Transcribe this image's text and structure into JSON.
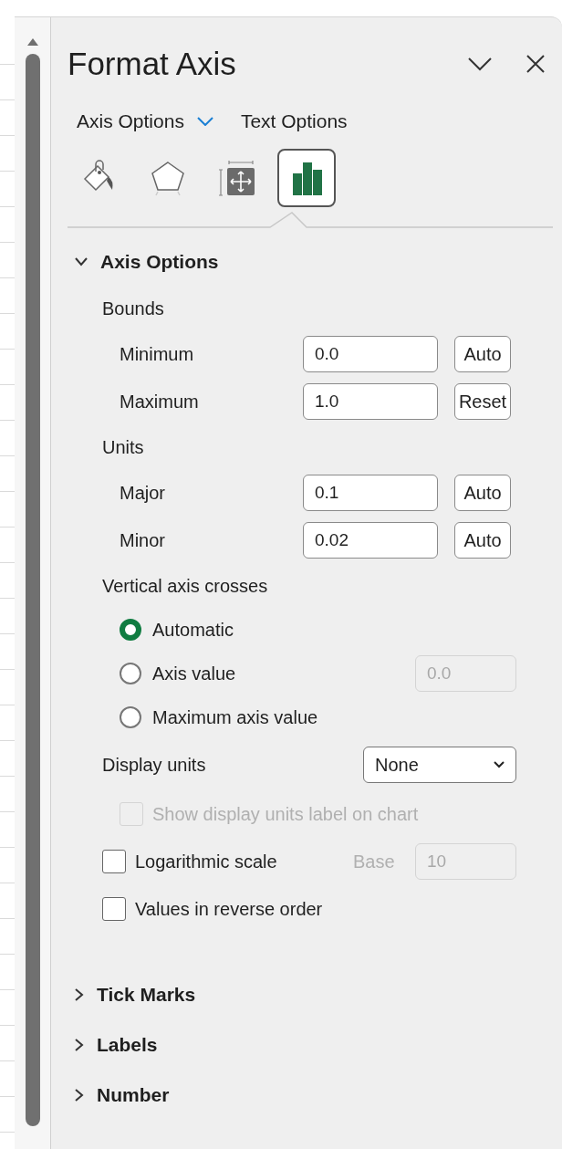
{
  "title": "Format Axis",
  "option_tabs": [
    {
      "label": "Axis Options",
      "menu": true
    },
    {
      "label": "Text Options",
      "menu": false
    }
  ],
  "icon_tabs": [
    {
      "kind": "fill",
      "selected": false
    },
    {
      "kind": "effects",
      "selected": false
    },
    {
      "kind": "size",
      "selected": false
    },
    {
      "kind": "axis",
      "selected": true
    }
  ],
  "sections": [
    {
      "title": "Axis Options",
      "expanded": true,
      "items": [
        {
          "kind": "heading",
          "label": "Bounds"
        },
        {
          "kind": "bound",
          "label": "Minimum",
          "value": "0.0",
          "button": "Auto"
        },
        {
          "kind": "bound",
          "label": "Maximum",
          "value": "1.0",
          "button": "Reset"
        },
        {
          "kind": "heading",
          "label": "Units"
        },
        {
          "kind": "bound",
          "label": "Major",
          "value": "0.1",
          "button": "Auto"
        },
        {
          "kind": "bound",
          "label": "Minor",
          "value": "0.02",
          "button": "Auto"
        },
        {
          "kind": "heading",
          "label": "Vertical axis crosses"
        },
        {
          "kind": "radio",
          "label": "Automatic",
          "selected": true
        },
        {
          "kind": "radio",
          "label": "Axis value",
          "selected": false,
          "field": {
            "value": "0.0",
            "disabled": true
          }
        },
        {
          "kind": "radio",
          "label": "Maximum axis value",
          "selected": false
        },
        {
          "kind": "select",
          "label": "Display units",
          "value": "None"
        },
        {
          "kind": "checkbox",
          "label": "Show display units label on chart",
          "checked": false,
          "disabled": true
        },
        {
          "kind": "checkbox",
          "label": "Logarithmic scale",
          "checked": false,
          "disabled": false,
          "side_label": "Base",
          "field": {
            "value": "10",
            "disabled": true
          }
        },
        {
          "kind": "checkbox",
          "label": "Values in reverse order",
          "checked": false,
          "disabled": false
        }
      ]
    },
    {
      "title": "Tick Marks",
      "expanded": false
    },
    {
      "title": "Labels",
      "expanded": false
    },
    {
      "title": "Number",
      "expanded": false
    }
  ]
}
